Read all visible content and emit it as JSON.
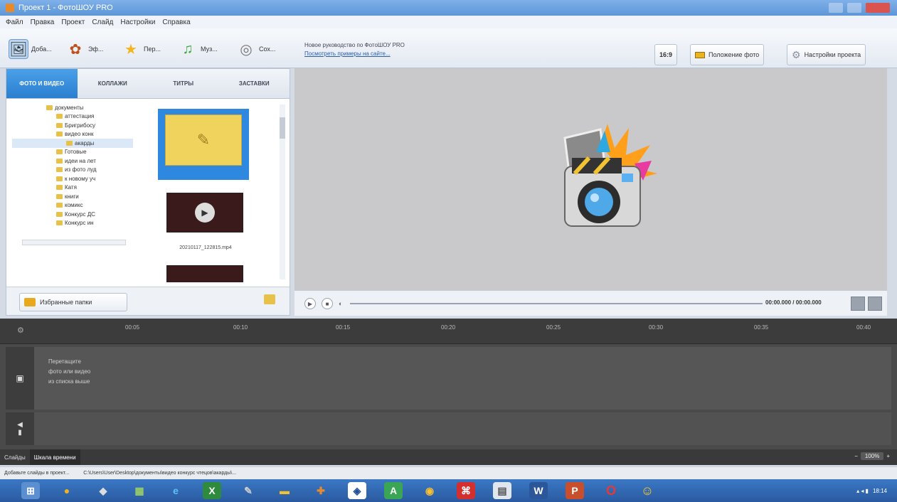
{
  "window": {
    "title": "Проект 1 - ФотоШОУ PRO"
  },
  "menu": [
    "Файл",
    "Правка",
    "Проект",
    "Слайд",
    "Настройки",
    "Справка"
  ],
  "toolbar": {
    "buttons": [
      {
        "label": "Доба...",
        "icon": "add-photo-icon"
      },
      {
        "label": "Эф...",
        "icon": "effects-icon"
      },
      {
        "label": "Пер...",
        "icon": "transitions-star-icon"
      },
      {
        "label": "Муз...",
        "icon": "music-note-icon"
      },
      {
        "label": "Сох...",
        "icon": "save-film-icon"
      }
    ],
    "hints": [
      "Новое руководство по ФотоШОУ PRO",
      "Посмотреть примеры на сайте..."
    ],
    "aspect": "16:9",
    "photo_position": "Положение фото",
    "project_settings": "Настройки проекта"
  },
  "tabs": [
    "ФОТО И ВИДЕО",
    "КОЛЛАЖИ",
    "ТИТРЫ",
    "ЗАСТАВКИ"
  ],
  "tree": [
    {
      "label": "документы",
      "indent": 0
    },
    {
      "label": "аттестация",
      "indent": 1
    },
    {
      "label": "Бригрибосу",
      "indent": 1
    },
    {
      "label": "видео конк",
      "indent": 1
    },
    {
      "label": "акарды",
      "indent": 2
    },
    {
      "label": "Готовые",
      "indent": 1
    },
    {
      "label": "идеи на лет",
      "indent": 1
    },
    {
      "label": "из фото луд",
      "indent": 1
    },
    {
      "label": "к новому уч",
      "indent": 1
    },
    {
      "label": "Катя",
      "indent": 1
    },
    {
      "label": "книги",
      "indent": 1
    },
    {
      "label": "комикс",
      "indent": 1
    },
    {
      "label": "Конкурс ДС",
      "indent": 1
    },
    {
      "label": "Конкурс ин",
      "indent": 1
    }
  ],
  "thumbs": {
    "video_caption": "20210117_122815.mp4"
  },
  "favorites_button": "Избранные папки",
  "player": {
    "time": "00:00.000 / 00:00.000"
  },
  "timeline": {
    "ticks": [
      "00:05",
      "00:10",
      "00:15",
      "00:20",
      "00:25",
      "00:30",
      "00:35",
      "00:40"
    ],
    "hint_lines": [
      "Перетащите",
      "фото или видео",
      "из списка выше"
    ],
    "tabs": [
      "Слайды",
      "Шкала времени"
    ],
    "zoom": "100%"
  },
  "status": {
    "left": "Добавьте слайды в проект...",
    "path": "C:\\Users\\User\\Desktop\\документы\\видео конкурс чтецов\\акарды\\..."
  },
  "taskbar": {
    "apps": [
      "start",
      "ps-app",
      "explorer",
      "calc",
      "ie",
      "excel",
      "paint",
      "folder",
      "tools",
      "security",
      "a-app",
      "chrome",
      "pdf",
      "doc",
      "word",
      "ppt",
      "opera",
      "emoji"
    ],
    "time": "18:14"
  },
  "colors": {
    "accent": "#2b7fd0",
    "timeline": "#4a4a4a",
    "taskbar": "#2a5aa0"
  }
}
